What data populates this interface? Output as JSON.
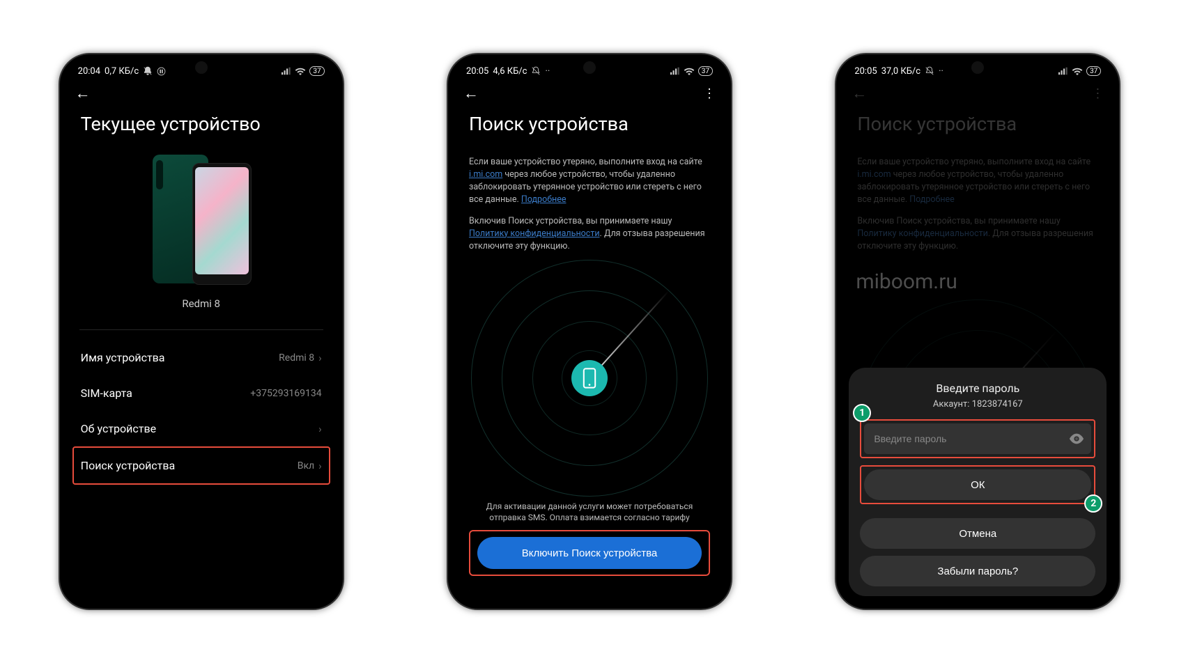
{
  "screen1": {
    "status": {
      "time": "20:04",
      "data_rate": "0,7 КБ/с",
      "battery": "37"
    },
    "title": "Текущее устройство",
    "device_name": "Redmi 8",
    "rows": {
      "device_name_label": "Имя устройства",
      "device_name_value": "Redmi 8",
      "sim_label": "SIM-карта",
      "sim_value": "+375293169134",
      "about_label": "Об устройстве",
      "find_label": "Поиск устройства",
      "find_value": "Вкл"
    }
  },
  "screen2": {
    "status": {
      "time": "20:05",
      "data_rate": "4,6 КБ/с",
      "battery": "37"
    },
    "title": "Поиск устройства",
    "desc1_a": "Если ваше устройство утеряно, выполните вход на сайте ",
    "desc1_link": "i.mi.com",
    "desc1_b": " через любое устройство, чтобы удаленно заблокировать утерянное устройство или стереть с него все данные. ",
    "desc1_more": "Подробнее",
    "desc2_a": "Включив Поиск устройства, вы принимаете нашу ",
    "desc2_link": "Политику конфиденциальности",
    "desc2_b": ". Для отзыва разрешения отключите эту функцию.",
    "activation_text": "Для активации данной услуги может потребоваться отправка SMS. Оплата взимается согласно тарифу",
    "button": "Включить Поиск устройства"
  },
  "screen3": {
    "status": {
      "time": "20:05",
      "data_rate": "37,0 КБ/с",
      "battery": "37"
    },
    "title": "Поиск устройства",
    "watermark": "miboom.ru",
    "dialog": {
      "title": "Введите пароль",
      "account_label": "Аккаунт: 1823874167",
      "placeholder": "Введите пароль",
      "ok": "ОК",
      "cancel": "Отмена",
      "forgot": "Забыли пароль?"
    },
    "callouts": {
      "one": "1",
      "two": "2"
    }
  }
}
